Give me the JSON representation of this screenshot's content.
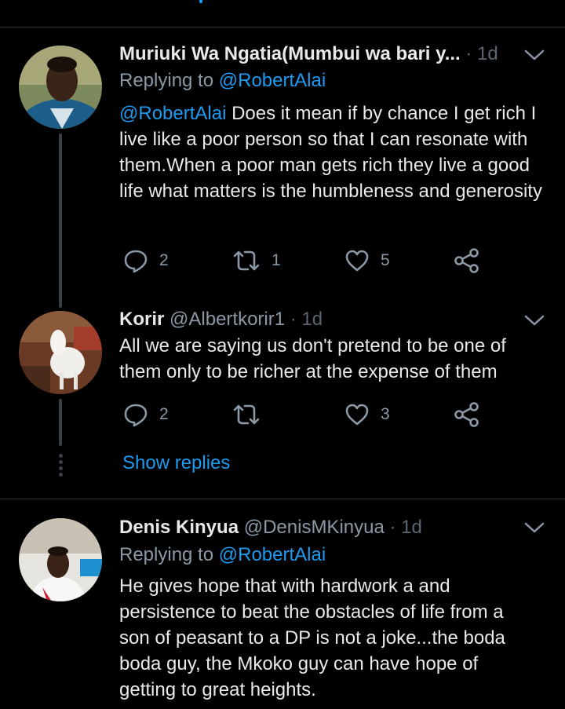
{
  "tweets": [
    {
      "name": "Muriuki Wa  Ngatia(Mumbui wa  bari y...",
      "time_sep": " · ",
      "time": "1d",
      "replying_prefix": "Replying to ",
      "replying_handle": "@RobertAlai",
      "mention": "@RobertAlai",
      "body": " Does it mean if by chance I get rich I live like a poor person so that I can resonate with them.When a poor man gets rich they live a good life what matters is the humbleness and generosity",
      "reply_count": "2",
      "retweet_count": "1",
      "like_count": "5"
    },
    {
      "name": "Korir",
      "handle": " @Albertkorir1",
      "time_sep": " · ",
      "time": "1d",
      "body": "All we are saying us don't pretend to be one of them only to be richer at the expense of them",
      "reply_count": "2",
      "retweet_count": "",
      "like_count": "3"
    },
    {
      "name": "Denis Kinyua",
      "handle": " @DenisMKinyua",
      "time_sep": " · ",
      "time": "1d",
      "replying_prefix": "Replying to ",
      "replying_handle": "@RobertAlai",
      "body": "He gives hope that with hardwork a and persistence to beat the obstacles of life from a son of peasant to a DP is not a joke...the boda boda guy, the Mkoko guy can have hope of getting to great heights."
    }
  ],
  "show_replies": "Show replies",
  "colors": {
    "accent": "#1d9bf0",
    "muted": "#8b98a5",
    "background": "#000000"
  },
  "icons": [
    "reply-icon",
    "retweet-icon",
    "like-icon",
    "share-icon",
    "chevron-down-icon"
  ]
}
